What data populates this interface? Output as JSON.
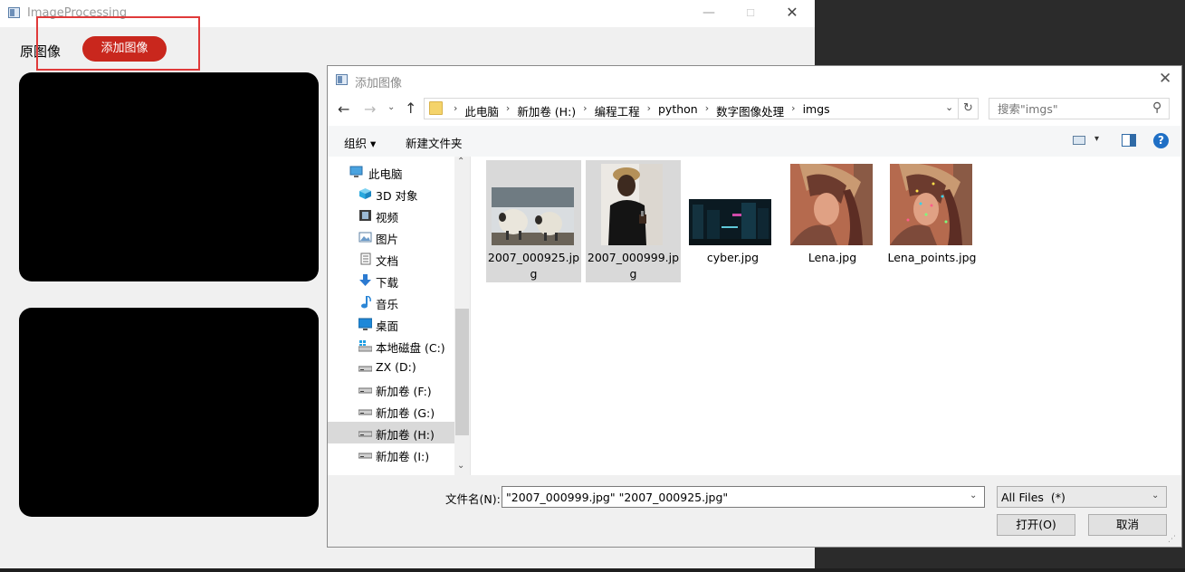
{
  "main_window": {
    "title": "ImageProcessing",
    "min_glyph": "—",
    "max_glyph": "☐",
    "close_glyph": "✕",
    "orig_label": "原图像",
    "add_image_button": "添加图像",
    "highlight_color": "#e03a3a",
    "button_color": "#c9271d"
  },
  "dialog": {
    "title": "添加图像",
    "close_glyph": "✕",
    "nav": {
      "back_glyph": "←",
      "forward_glyph": "→",
      "recent_glyph": "⌄",
      "up_glyph": "↑",
      "breadcrumbs": [
        "此电脑",
        "新加卷 (H:)",
        "编程工程",
        "python",
        "数字图像处理",
        "imgs"
      ],
      "crumb_separator": "›",
      "dropdown_glyph": "⌄",
      "refresh_glyph": "↻",
      "search_placeholder": "搜索\"imgs\"",
      "search_glyph": "⚲"
    },
    "toolbar": {
      "organize": "组织 ▾",
      "new_folder": "新建文件夹",
      "view_dropdown_glyph": "▾",
      "help_glyph": "?"
    },
    "nav_pane": {
      "scroll_up_glyph": "⌃",
      "scroll_down_glyph": "⌄",
      "items": [
        {
          "label": "此电脑",
          "icon": "computer-icon",
          "selected": false
        },
        {
          "label": "3D 对象",
          "icon": "3d-objects-icon",
          "selected": false
        },
        {
          "label": "视频",
          "icon": "video-icon",
          "selected": false
        },
        {
          "label": "图片",
          "icon": "pictures-icon",
          "selected": false
        },
        {
          "label": "文档",
          "icon": "documents-icon",
          "selected": false
        },
        {
          "label": "下载",
          "icon": "download-icon",
          "selected": false
        },
        {
          "label": "音乐",
          "icon": "music-icon",
          "selected": false
        },
        {
          "label": "桌面",
          "icon": "desktop-icon",
          "selected": false
        },
        {
          "label": "本地磁盘 (C:)",
          "icon": "windows-drive-icon",
          "selected": false
        },
        {
          "label": "ZX (D:)",
          "icon": "drive-icon",
          "selected": false
        },
        {
          "label": "新加卷 (F:)",
          "icon": "drive-icon",
          "selected": false
        },
        {
          "label": "新加卷 (G:)",
          "icon": "drive-icon",
          "selected": false
        },
        {
          "label": "新加卷 (H:)",
          "icon": "drive-icon",
          "selected": true
        },
        {
          "label": "新加卷 (I:)",
          "icon": "drive-icon",
          "selected": false
        }
      ]
    },
    "files": [
      {
        "name": "2007_000925.jpg",
        "selected": true,
        "thumb": "sheep"
      },
      {
        "name": "2007_000999.jpg",
        "selected": true,
        "thumb": "person"
      },
      {
        "name": "cyber.jpg",
        "selected": false,
        "thumb": "city"
      },
      {
        "name": "Lena.jpg",
        "selected": false,
        "thumb": "lena"
      },
      {
        "name": "Lena_points.jpg",
        "selected": false,
        "thumb": "lena-points"
      }
    ],
    "bottom": {
      "filename_label": "文件名(N):",
      "filename_value": "\"2007_000999.jpg\" \"2007_000925.jpg\"",
      "filetype_value": "All Files  (*)",
      "dropdown_glyph": "⌄",
      "open_button": "打开(O)",
      "cancel_button": "取消",
      "grip_glyph": "⋰"
    }
  }
}
